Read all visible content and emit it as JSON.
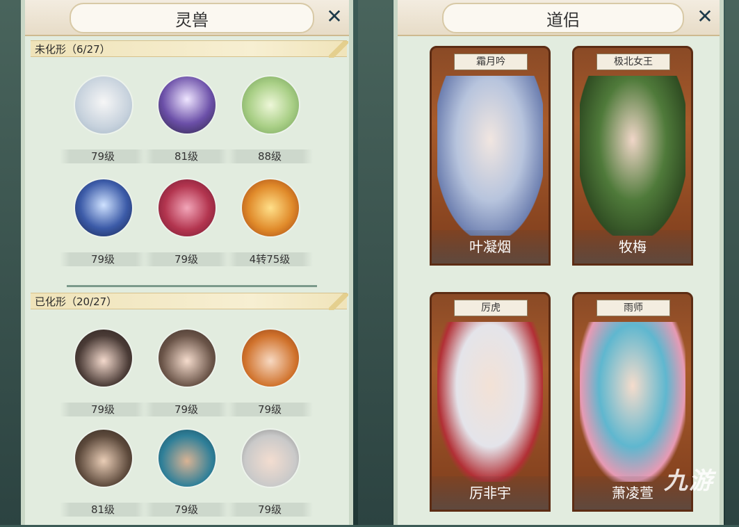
{
  "left_panel": {
    "title": "灵兽",
    "unformed": {
      "label": "未化形（6/27）",
      "beasts": [
        {
          "level": "79级",
          "icon": "white-wolf-icon"
        },
        {
          "level": "81级",
          "icon": "eagle-icon"
        },
        {
          "level": "88级",
          "icon": "green-dragon-icon"
        },
        {
          "level": "79级",
          "icon": "blue-dragon-icon"
        },
        {
          "level": "79级",
          "icon": "scorpion-icon"
        },
        {
          "level": "4转75级",
          "icon": "lion-icon"
        }
      ]
    },
    "formed": {
      "label": "已化形（20/27）",
      "beasts": [
        {
          "level": "79级",
          "icon": "female-portrait-icon"
        },
        {
          "level": "79级",
          "icon": "female-portrait-icon"
        },
        {
          "level": "79级",
          "icon": "male-portrait-icon"
        },
        {
          "level": "81级",
          "icon": "horned-portrait-icon"
        },
        {
          "level": "79级",
          "icon": "blue-hair-portrait-icon"
        },
        {
          "level": "79级",
          "icon": "white-hair-portrait-icon"
        }
      ]
    }
  },
  "right_panel": {
    "title": "道侣",
    "companions": [
      {
        "tag": "霜月吟",
        "name": "叶凝烟"
      },
      {
        "tag": "极北女王",
        "name": "牧梅"
      },
      {
        "tag": "厉虎",
        "name": "厉非宇"
      },
      {
        "tag": "雨师",
        "name": "萧凌萱"
      }
    ]
  },
  "watermark": "九游"
}
